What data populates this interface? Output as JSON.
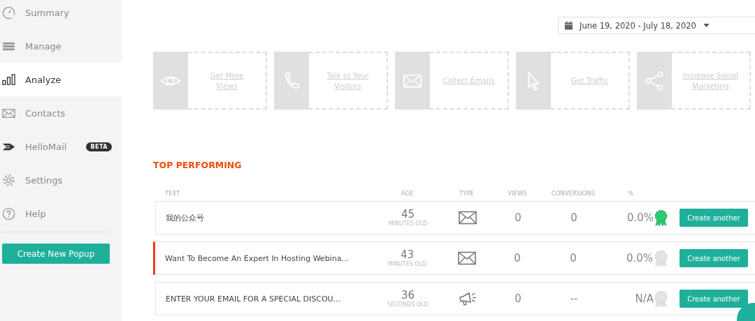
{
  "sidebar": {
    "items": [
      {
        "label": "Summary",
        "selected": false
      },
      {
        "label": "Manage",
        "selected": false
      },
      {
        "label": "Analyze",
        "selected": true
      },
      {
        "label": "Contacts",
        "selected": false
      },
      {
        "label": "HelloMail",
        "selected": false,
        "badge": "BETA"
      },
      {
        "label": "Settings",
        "selected": false
      },
      {
        "label": "Help",
        "selected": false
      }
    ],
    "create_button": "Create New Popup"
  },
  "date_range": "June 19, 2020 - July 18, 2020",
  "goals": [
    {
      "label": "Get More Views"
    },
    {
      "label": "Talk to Your Visitors"
    },
    {
      "label": "Collect Emails"
    },
    {
      "label": "Get Traffic"
    },
    {
      "label": "Increase Social Marketing"
    }
  ],
  "top_performing": {
    "title": "TOP PERFORMING",
    "columns": [
      "TEXT",
      "AGE",
      "TYPE",
      "VIEWS",
      "CONVERSIONS",
      "%"
    ],
    "rows": [
      {
        "text": "我的公众号",
        "age": "45",
        "age_unit": "MINUTES OLD",
        "kind": "email",
        "views": "0",
        "conversions": "0",
        "percent": "0.0%",
        "top": true,
        "highlighted": false,
        "button": "Create another"
      },
      {
        "text": "Want To Become An Expert In Hosting Webina...",
        "age": "43",
        "age_unit": "MINUTES OLD",
        "kind": "email",
        "views": "0",
        "conversions": "0",
        "percent": "0.0%",
        "top": false,
        "highlighted": true,
        "button": "Create another"
      },
      {
        "text": "ENTER YOUR EMAIL FOR A SPECIAL DISCOU...",
        "age": "36",
        "age_unit": "SECONDS OLD",
        "kind": "announcement",
        "views": "0",
        "conversions": "--",
        "percent": "N/A",
        "top": false,
        "highlighted": false,
        "button": "Create another"
      }
    ]
  }
}
